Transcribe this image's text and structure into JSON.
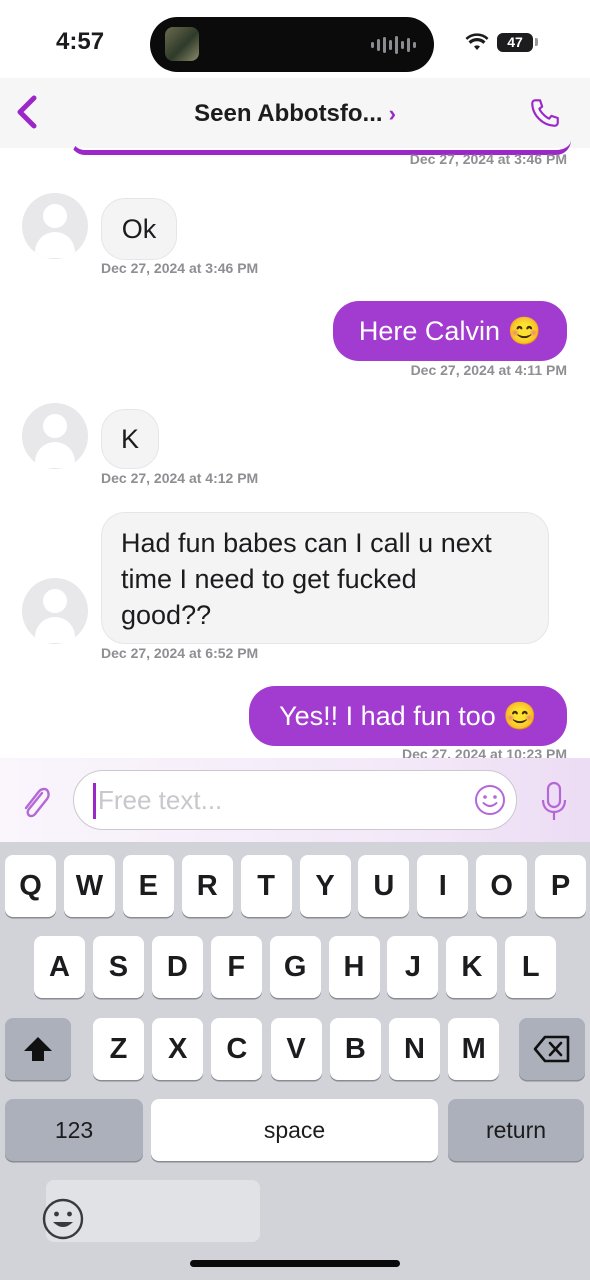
{
  "status": {
    "time": "4:57",
    "battery": "47"
  },
  "header": {
    "title": "Seen Abbotsfo...",
    "chevron": "›"
  },
  "messages": [
    {
      "direction": "out",
      "time": "Dec 27, 2024 at 3:46 PM"
    },
    {
      "direction": "in",
      "text": "Ok",
      "time": "Dec 27, 2024 at 3:46 PM"
    },
    {
      "direction": "out",
      "text": "Here Calvin 😊",
      "time": "Dec 27, 2024 at 4:11 PM"
    },
    {
      "direction": "in",
      "text": "K",
      "time": "Dec 27, 2024 at 4:12 PM"
    },
    {
      "direction": "in",
      "lines": [
        "Had fun babes can I call u next",
        "time I need to get fucked",
        "good??"
      ],
      "time": "Dec 27, 2024 at 6:52 PM"
    },
    {
      "direction": "out",
      "text": "Yes!! I had fun too 😊",
      "time": "Dec 27, 2024 at 10:23 PM"
    }
  ],
  "composer": {
    "placeholder": "Free text..."
  },
  "keyboard": {
    "row1": [
      "Q",
      "W",
      "E",
      "R",
      "T",
      "Y",
      "U",
      "I",
      "O",
      "P"
    ],
    "row2": [
      "A",
      "S",
      "D",
      "F",
      "G",
      "H",
      "J",
      "K",
      "L"
    ],
    "row3": [
      "Z",
      "X",
      "C",
      "V",
      "B",
      "N",
      "M"
    ],
    "numbers_label": "123",
    "space_label": "space",
    "return_label": "return"
  },
  "icons": {
    "back": "chevron-left-icon",
    "phone": "phone-icon",
    "attach": "paperclip-icon",
    "emoji": "smiley-icon",
    "mic": "microphone-icon",
    "shift": "shift-icon",
    "delete": "backspace-icon"
  },
  "colors": {
    "accent": "#9b27c9",
    "outgoing_bubble": "#a23bd0",
    "incoming_bubble": "#f4f4f5"
  }
}
